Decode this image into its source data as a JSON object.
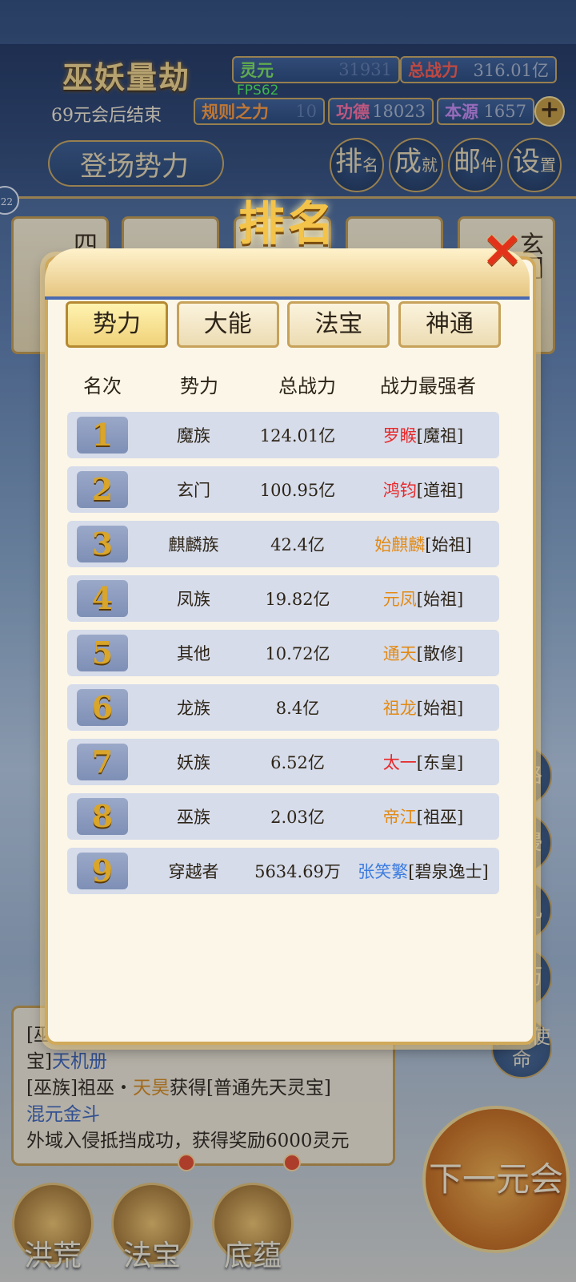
{
  "hud": {
    "title": "巫妖量劫",
    "countdown": "69元会后结束",
    "fps": "FPS62",
    "stats": {
      "lingyuan_label": "灵元",
      "lingyuan_value": "31931",
      "total_power_label": "总战力",
      "total_power_value": "316.01亿",
      "rule_power_label": "规则之力",
      "rule_power_value": "10",
      "merit_label": "功德",
      "merit_value": "18023",
      "origin_label": "本源",
      "origin_value": "1657"
    },
    "plus": "+",
    "appear_label": "登场势力",
    "top_buttons": [
      {
        "main": "排",
        "sub": "名"
      },
      {
        "main": "成",
        "sub": "就"
      },
      {
        "main": "邮",
        "sub": "件"
      },
      {
        "main": "设",
        "sub": "置"
      }
    ],
    "left_badge": "22"
  },
  "background": {
    "cards": [
      "四海汪洋",
      "",
      "",
      "",
      "玄门"
    ],
    "side_buttons": [
      "道路",
      "域侵",
      "道儿",
      "身历",
      "各族使命"
    ]
  },
  "log": {
    "line1_prefix": "[巫",
    "line2_a": "宝]",
    "line2_b": "天机册",
    "line3_a": "[巫族]祖巫・",
    "line3_b": "天昊",
    "line3_c": "获得[普通先天灵宝]",
    "line4": "混元金斗",
    "line5": "外域入侵抵挡成功，获得奖励6000灵元"
  },
  "bottom_nav": [
    "洪荒",
    "法宝",
    "底蕴"
  ],
  "next_button": "下一元会",
  "modal": {
    "title": "排名",
    "close": "✕",
    "tabs": [
      "势力",
      "大能",
      "法宝",
      "神通"
    ],
    "headers": [
      "名次",
      "势力",
      "总战力",
      "战力最强者"
    ],
    "rows": [
      {
        "rank": "1",
        "faction": "魔族",
        "power": "124.01亿",
        "leader": "罗睺",
        "title": "[魔祖]",
        "color": "#e8282a"
      },
      {
        "rank": "2",
        "faction": "玄门",
        "power": "100.95亿",
        "leader": "鸿钧",
        "title": "[道祖]",
        "color": "#e8282a"
      },
      {
        "rank": "3",
        "faction": "麒麟族",
        "power": "42.4亿",
        "leader": "始麒麟",
        "title": "[始祖]",
        "color": "#e38a14"
      },
      {
        "rank": "4",
        "faction": "凤族",
        "power": "19.82亿",
        "leader": "元凤",
        "title": "[始祖]",
        "color": "#e38a14"
      },
      {
        "rank": "5",
        "faction": "其他",
        "power": "10.72亿",
        "leader": "通天",
        "title": "[散修]",
        "color": "#e38a14"
      },
      {
        "rank": "6",
        "faction": "龙族",
        "power": "8.4亿",
        "leader": "祖龙",
        "title": "[始祖]",
        "color": "#e38a14"
      },
      {
        "rank": "7",
        "faction": "妖族",
        "power": "6.52亿",
        "leader": "太一",
        "title": "[东皇]",
        "color": "#e8282a"
      },
      {
        "rank": "8",
        "faction": "巫族",
        "power": "2.03亿",
        "leader": "帝江",
        "title": "[祖巫]",
        "color": "#e38a14"
      },
      {
        "rank": "9",
        "faction": "穿越者",
        "power": "5634.69万",
        "leader": "张笑繁",
        "title": "[碧泉逸士]",
        "color": "#3a7be0"
      }
    ]
  }
}
